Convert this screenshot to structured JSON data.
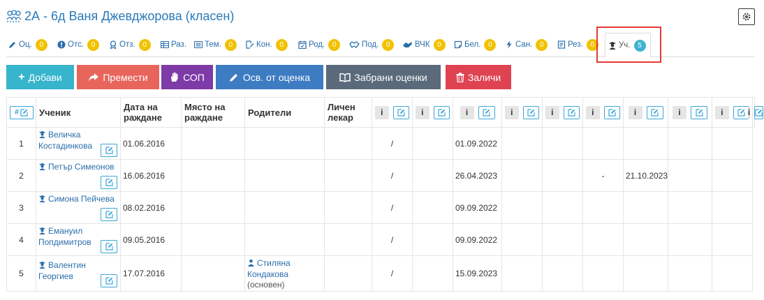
{
  "header": {
    "title": "2А - 6д Ваня Джевджорова (класен)",
    "title_icon": "class-users-icon",
    "settings_icon": "gear-icon"
  },
  "tabs": [
    {
      "label": "Оц.",
      "count": "0",
      "icon": "pencil-icon"
    },
    {
      "label": "Отс.",
      "count": "0",
      "icon": "exclamation-icon"
    },
    {
      "label": "Отз.",
      "count": "0",
      "icon": "medal-icon"
    },
    {
      "label": "Раз.",
      "count": "",
      "icon": "table-icon"
    },
    {
      "label": "Тем.",
      "count": "0",
      "icon": "list-icon"
    },
    {
      "label": "Кон.",
      "count": "0",
      "icon": "edit-doc-icon"
    },
    {
      "label": "Род.",
      "count": "0",
      "icon": "calendar-icon"
    },
    {
      "label": "Под.",
      "count": "0",
      "icon": "handshake-icon"
    },
    {
      "label": "ВЧК",
      "count": "0",
      "icon": "hands-icon"
    },
    {
      "label": "Бел.",
      "count": "0",
      "icon": "note-icon"
    },
    {
      "label": "Сан.",
      "count": "0",
      "icon": "bolt-icon"
    },
    {
      "label": "Рез.",
      "count": "0",
      "icon": "document-icon"
    },
    {
      "label": "Уч.",
      "count": "5",
      "icon": "student-icon",
      "active": true
    }
  ],
  "actions": [
    {
      "label": "Добави",
      "icon": "plus-icon",
      "color": "#36b5cd"
    },
    {
      "label": "Премести",
      "icon": "share-icon",
      "color": "#e8655b"
    },
    {
      "label": "СОП",
      "icon": "hand-icon",
      "color": "#7e3aa6"
    },
    {
      "label": "Осв. от оценка",
      "icon": "pencil-icon",
      "color": "#3d7bc2"
    },
    {
      "label": "Забрани оценки",
      "icon": "book-icon",
      "color": "#5a6a7a"
    },
    {
      "label": "Заличи",
      "icon": "trash-icon",
      "color": "#df4352"
    }
  ],
  "table": {
    "headers": {
      "num": "#",
      "student": "Ученик",
      "birthdate": "Дата на раждане",
      "birthplace": "Място на раждане",
      "parents": "Родители",
      "doctor": "Личен лекар"
    },
    "rows": [
      {
        "num": "1",
        "name_line1": "Величка",
        "name_line2": "Костадинкова",
        "birthdate": "01.06.2016",
        "birthplace": "",
        "parent": "",
        "parent_note": "",
        "doctor": "",
        "c1": "/",
        "c2": "",
        "c3": "01.09.2022",
        "c4": "",
        "c5": "",
        "c6": "",
        "c7": "",
        "c8": "",
        "c9": ""
      },
      {
        "num": "2",
        "name_line1": "Петър Симеонов",
        "name_line2": "",
        "birthdate": "16.06.2016",
        "birthplace": "",
        "parent": "",
        "parent_note": "",
        "doctor": "",
        "c1": "/",
        "c2": "",
        "c3": "26.04.2023",
        "c4": "",
        "c5": "",
        "c6": "-",
        "c7": "21.10.2023",
        "c8": "",
        "c9": ""
      },
      {
        "num": "3",
        "name_line1": "Симона Пейчева",
        "name_line2": "",
        "birthdate": "08.02.2016",
        "birthplace": "",
        "parent": "",
        "parent_note": "",
        "doctor": "",
        "c1": "/",
        "c2": "",
        "c3": "09.09.2022",
        "c4": "",
        "c5": "",
        "c6": "",
        "c7": "",
        "c8": "",
        "c9": ""
      },
      {
        "num": "4",
        "name_line1": "Емануил",
        "name_line2": "Попдимитров",
        "birthdate": "09.05.2016",
        "birthplace": "",
        "parent": "",
        "parent_note": "",
        "doctor": "",
        "c1": "/",
        "c2": "",
        "c3": "09.09.2022",
        "c4": "",
        "c5": "",
        "c6": "",
        "c7": "",
        "c8": "",
        "c9": ""
      },
      {
        "num": "5",
        "name_line1": "Валентин",
        "name_line2": "Георгиев",
        "birthdate": "17.07.2016",
        "birthplace": "",
        "parent": "Стиляна Кондакова",
        "parent_note": "(основен)",
        "doctor": "",
        "c1": "/",
        "c2": "",
        "c3": "15.09.2023",
        "c4": "",
        "c5": "",
        "c6": "",
        "c7": "",
        "c8": "",
        "c9": ""
      }
    ]
  }
}
